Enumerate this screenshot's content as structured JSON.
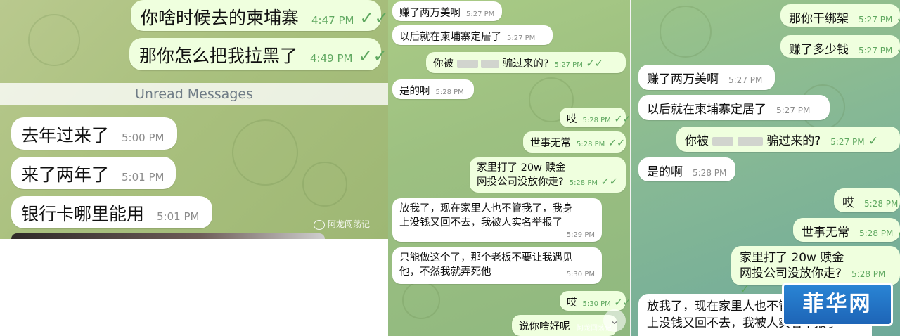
{
  "panel1": {
    "unread_label": "Unread Messages",
    "watermark": "阿龙闯荡记",
    "messages": [
      {
        "dir": "out",
        "text": "你啥时候去的柬埔寨",
        "time": "4:47 PM",
        "ticks": "✓✓"
      },
      {
        "dir": "out",
        "text": "那你怎么把我拉黑了",
        "time": "4:49 PM",
        "ticks": "✓✓"
      },
      {
        "dir": "in",
        "text": "去年过来了",
        "time": "5:00 PM"
      },
      {
        "dir": "in",
        "text": "来了两年了",
        "time": "5:01 PM"
      },
      {
        "dir": "in",
        "text": "银行卡哪里能用",
        "time": "5:01 PM"
      }
    ]
  },
  "panel2": {
    "watermark": "阿龙闯荡记",
    "scroll_icon": "chevron-down-icon",
    "messages": [
      {
        "dir": "in",
        "text": "赚了两万美啊",
        "time": "5:27 PM"
      },
      {
        "dir": "in",
        "text": "以后就在柬埔寨定居了",
        "time": "5:27 PM"
      },
      {
        "dir": "out",
        "text_a": "你被",
        "text_b": "骗过来的?",
        "time": "5:27 PM",
        "ticks": "✓✓"
      },
      {
        "dir": "in",
        "text": "是的啊",
        "time": "5:28 PM"
      },
      {
        "dir": "out",
        "text": "哎",
        "time": "5:28 PM",
        "ticks": "✓✓"
      },
      {
        "dir": "out",
        "text": "世事无常",
        "time": "5:28 PM",
        "ticks": "✓✓"
      },
      {
        "dir": "out",
        "line1": "家里打了 20w 赎金",
        "line2": "网投公司没放你走?",
        "time": "5:28 PM",
        "ticks": "✓✓"
      },
      {
        "dir": "in",
        "line1": "放我了，现在家里人也不管我了，我身",
        "line2": "上没钱又回不去，我被人实名举报了",
        "time": "5:29 PM"
      },
      {
        "dir": "in",
        "line1": "只能做这个了，那个老板不要让我遇见",
        "line2": "他，不然我就弄死他",
        "time": "5:30 PM"
      },
      {
        "dir": "out",
        "text": "哎",
        "time": "5:30 PM",
        "ticks": "✓✓"
      },
      {
        "dir": "out",
        "text": "说你啥好呢",
        "time": ""
      }
    ]
  },
  "panel3": {
    "logo": "菲华网",
    "messages": [
      {
        "dir": "out",
        "text": "那你干绑架",
        "time": "5:27 PM",
        "ticks": "✓"
      },
      {
        "dir": "out",
        "text": "赚了多少钱",
        "time": "5:27 PM",
        "ticks": "✓"
      },
      {
        "dir": "in",
        "text": "赚了两万美啊",
        "time": "5:27 PM"
      },
      {
        "dir": "in",
        "text": "以后就在柬埔寨定居了",
        "time": "5:27 PM"
      },
      {
        "dir": "out",
        "text_a": "你被",
        "text_b": "骗过来的?",
        "time": "5:27 PM",
        "ticks": "✓"
      },
      {
        "dir": "in",
        "text": "是的啊",
        "time": "5:28 PM"
      },
      {
        "dir": "out",
        "text": "哎",
        "time": "5:28 PM",
        "ticks": "✓"
      },
      {
        "dir": "out",
        "text": "世事无常",
        "time": "5:28 PM",
        "ticks": "✓"
      },
      {
        "dir": "out",
        "line1": "家里打了 20w 赎金",
        "line2": "网投公司没放你走?",
        "time": "5:28 PM",
        "ticks": "✓"
      },
      {
        "dir": "in",
        "line1": "放我了，现在家里人也不管我了，我身",
        "line2": "上没钱又回不去，我被人实名举报了",
        "time": ""
      }
    ]
  }
}
